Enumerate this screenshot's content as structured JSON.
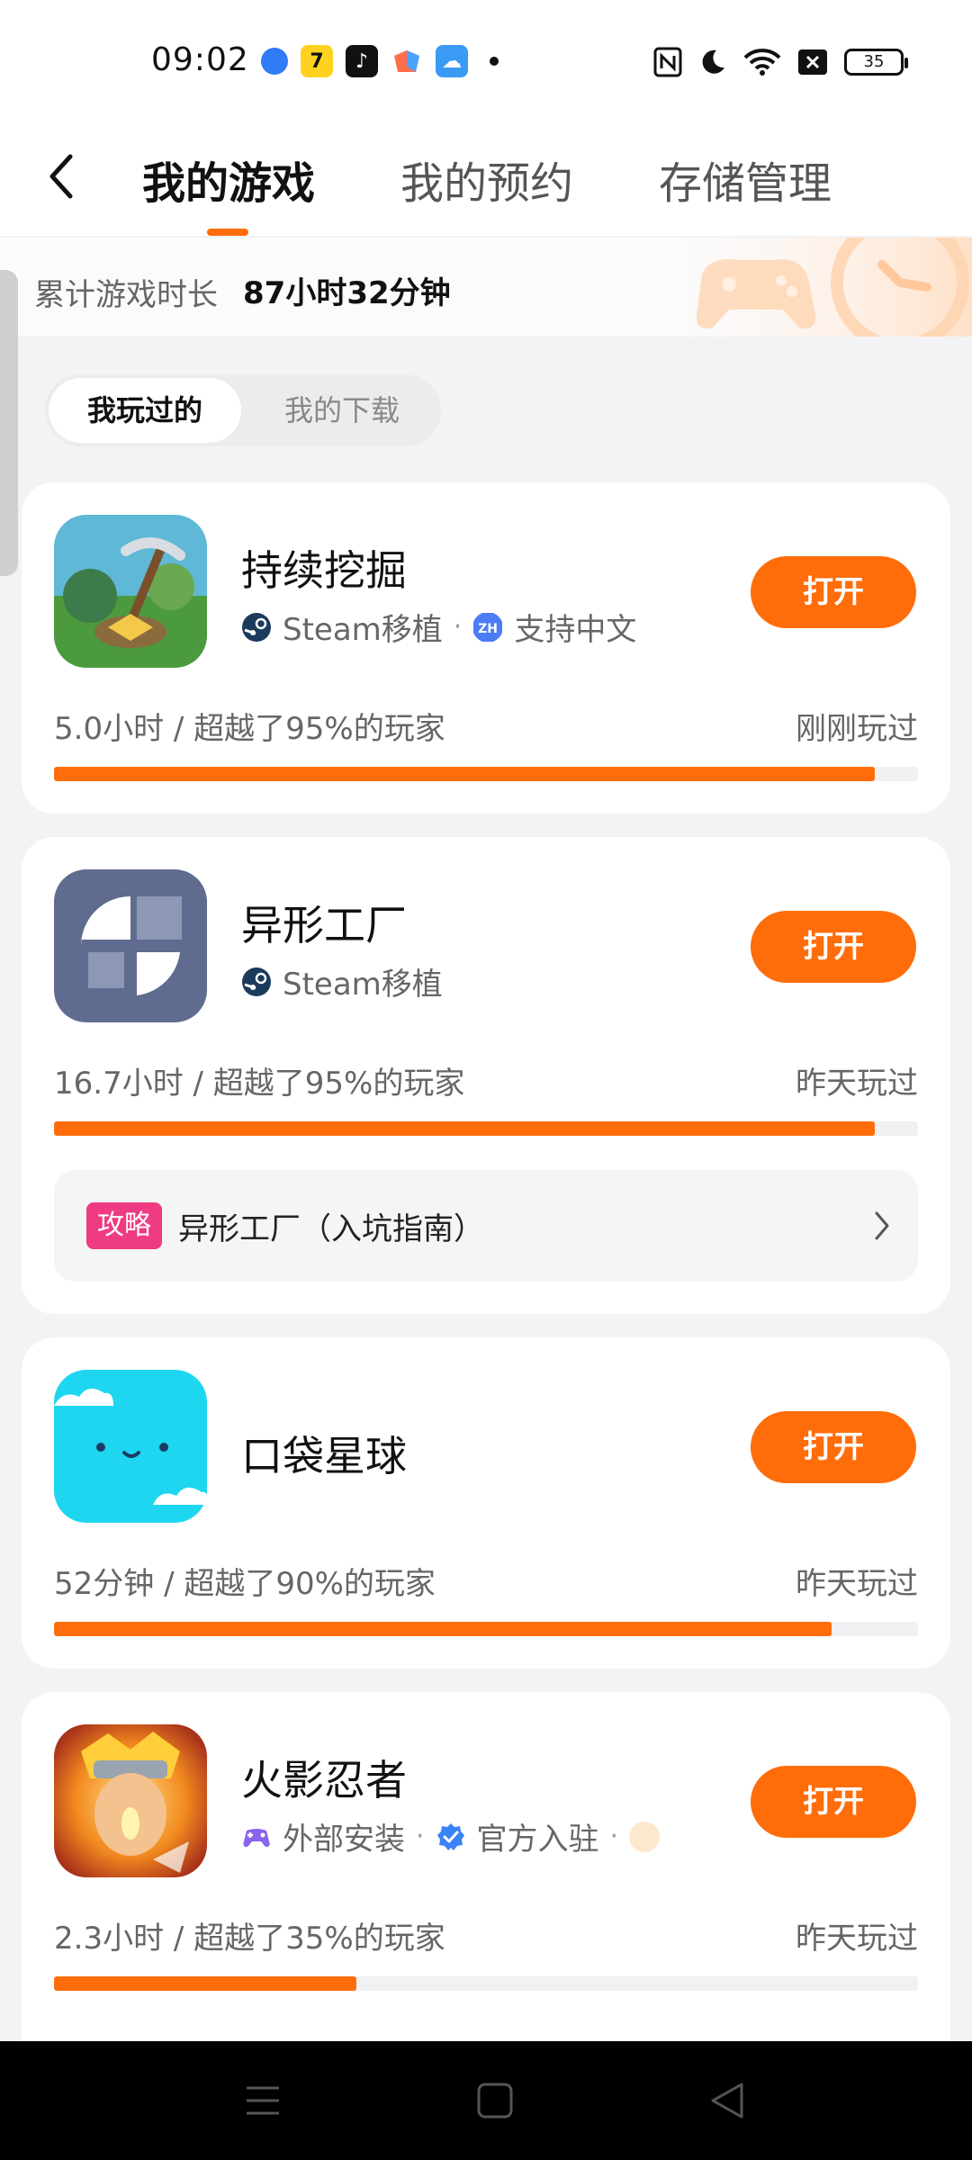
{
  "status_bar": {
    "time": "09:02",
    "battery": "35"
  },
  "nav": {
    "tabs": [
      {
        "label": "我的游戏",
        "active": true
      },
      {
        "label": "我的预约",
        "active": false
      },
      {
        "label": "存储管理",
        "active": false
      }
    ]
  },
  "summary": {
    "label": "累计游戏时长",
    "value": "87小时32分钟"
  },
  "segment": {
    "items": [
      "我玩过的",
      "我的下载"
    ],
    "selected": "我玩过的"
  },
  "games": [
    {
      "title": "持续挖掘",
      "tags": [
        "Steam移植",
        "支持中文"
      ],
      "open_label": "打开",
      "stats": "5.0小时 / 超越了95%的玩家",
      "last_played": "刚刚玩过",
      "progress": 0.95
    },
    {
      "title": "异形工厂",
      "tags": [
        "Steam移植"
      ],
      "open_label": "打开",
      "stats": "16.7小时 / 超越了95%的玩家",
      "last_played": "昨天玩过",
      "progress": 0.95,
      "guide": {
        "badge": "攻略",
        "text": "异形工厂（入坑指南）"
      }
    },
    {
      "title": "口袋星球",
      "tags": [],
      "open_label": "打开",
      "stats": "52分钟 / 超越了90%的玩家",
      "last_played": "昨天玩过",
      "progress": 0.9
    },
    {
      "title": "火影忍者",
      "tags": [
        "外部安装",
        "官方入驻"
      ],
      "open_label": "打开",
      "stats": "2.3小时 / 超越了35%的玩家",
      "last_played": "昨天玩过",
      "progress": 0.35
    }
  ],
  "colors": {
    "accent": "#ff6d0a",
    "guide_badge": "#ef3b82"
  }
}
